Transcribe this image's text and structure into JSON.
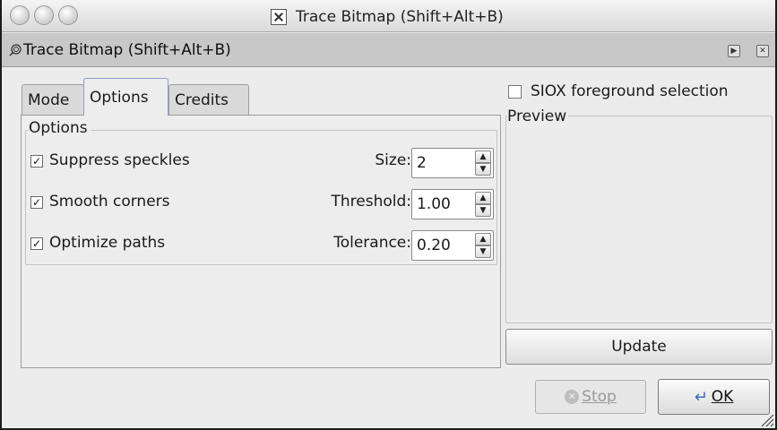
{
  "window": {
    "title": "Trace Bitmap (Shift+Alt+B)"
  },
  "dock": {
    "title": "Trace Bitmap (Shift+Alt+B)"
  },
  "tabs": [
    {
      "label": "Mode",
      "active": false
    },
    {
      "label": "Options",
      "active": true
    },
    {
      "label": "Credits",
      "active": false
    }
  ],
  "options": {
    "group_label": "Options",
    "rows": [
      {
        "label": "Suppress speckles",
        "checked": true,
        "field_label": "Size:",
        "value": "2"
      },
      {
        "label": "Smooth corners",
        "checked": true,
        "field_label": "Threshold:",
        "value": "1.00"
      },
      {
        "label": "Optimize paths",
        "checked": true,
        "field_label": "Tolerance:",
        "value": "0.20"
      }
    ]
  },
  "siox": {
    "label": "SIOX foreground selection",
    "checked": false
  },
  "preview": {
    "label": "Preview",
    "update_label": "Update"
  },
  "buttons": {
    "stop_label": "Stop",
    "ok_label": "OK"
  },
  "icons": {
    "window_icon": "x-window-icon",
    "dock_icon": "trace-bitmap-icon",
    "stop_icon": "stop-icon",
    "ok_icon": "ok-arrow-icon"
  }
}
